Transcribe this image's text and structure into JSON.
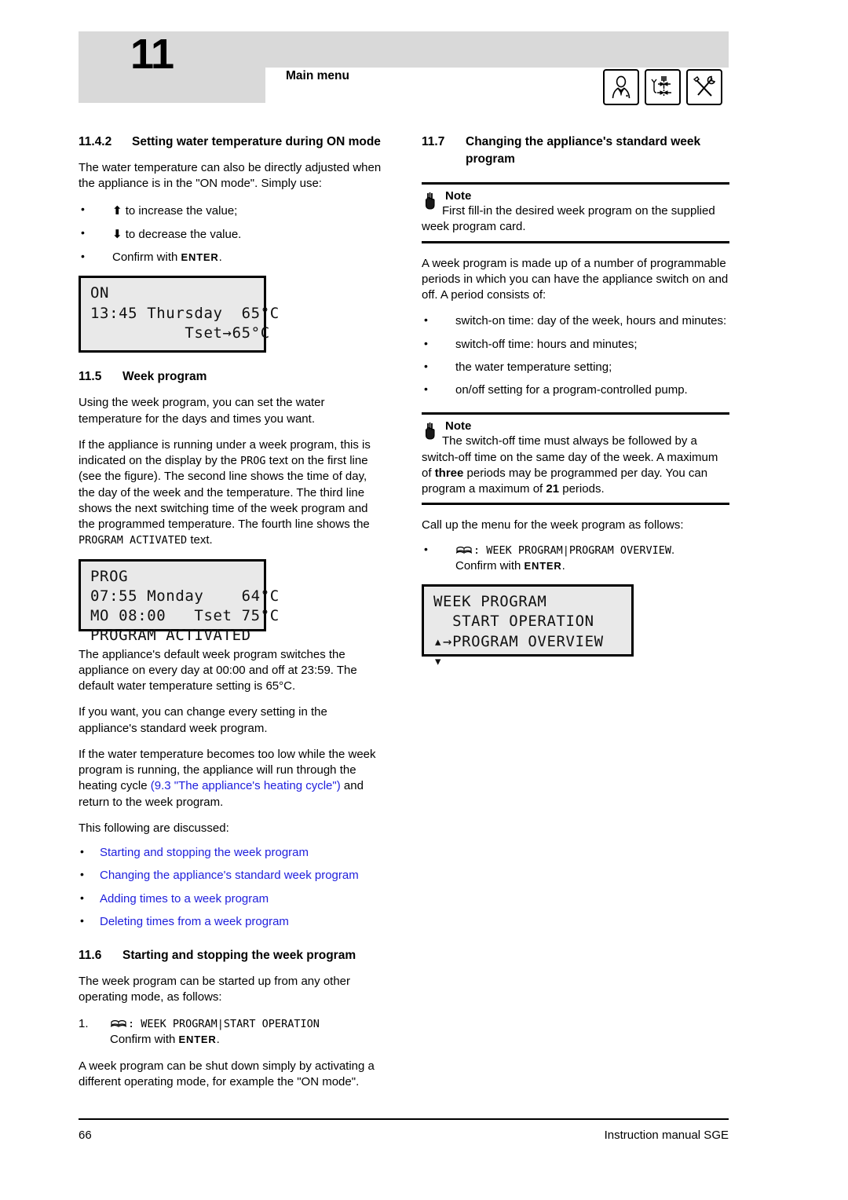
{
  "header": {
    "chapter_number": "11",
    "title": "Main menu",
    "icons": [
      "user-person-icon",
      "valve-piping-icon",
      "tools-crossed-icon"
    ]
  },
  "left_column": {
    "section_1142": {
      "number": "11.4.2",
      "title": "Setting water temperature during ON mode",
      "intro": "The water temperature can also be directly adjusted when the appliance is in the \"ON mode\". Simply use:",
      "bullets": [
        {
          "arrow": "⬆",
          "text": "to increase the value;"
        },
        {
          "arrow": "⬇",
          "text": "to decrease the value."
        },
        {
          "arrow": "",
          "text_before": "Confirm with ",
          "enter": "ENTER",
          "text_after": "."
        }
      ],
      "lcd": {
        "line1": "ON",
        "line2": "13:45 Thursday  65°C",
        "line3": "          Tset→65°C",
        "line4": ""
      }
    },
    "section_115": {
      "number": "11.5",
      "title": "Week program",
      "para1": "Using the week program, you can set the water temperature for the days and times you want.",
      "para2_a": "If the appliance is running under a week program, this is indicated on the display by the ",
      "para2_mono1": "PROG",
      "para2_b": " text on the first line (see the figure). The second line shows the time of day, the day of the week and the temperature. The third line shows the next switching time of the week program and the programmed temperature. The fourth line shows the ",
      "para2_mono2": "PROGRAM ACTIVATED",
      "para2_c": " text.",
      "lcd": {
        "line1": "PROG",
        "line2": "07:55 Monday    64°C",
        "line3": "MO 08:00   Tset 75°C",
        "line4": "PROGRAM ACTIVATED"
      },
      "para3": "The appliance's default week program switches the appliance on every day at 00:00 and off at 23:59. The default water temperature setting is 65°C.",
      "para4": "If you want, you can change every setting in the appliance's standard week program.",
      "para5_a": "If the water temperature becomes too low while the week program is running, the appliance will run through the heating cycle ",
      "para5_link": "(9.3 \"The appliance's heating cycle\")",
      "para5_b": " and return to the week program.",
      "para6": "This following are discussed:",
      "link_list": [
        "Starting and stopping the week program",
        "Changing the appliance's standard week program",
        "Adding times to a week program",
        "Deleting times from a week program"
      ]
    },
    "section_116": {
      "number": "11.6",
      "title": "Starting and stopping the week program",
      "para1": "The week program can be started up from any other operating mode, as follows:",
      "step_number": "1.",
      "step_icon": "book-menu-icon",
      "step_mono": ": WEEK PROGRAM|START OPERATION",
      "step_confirm_before": "Confirm with ",
      "step_confirm_enter": "ENTER",
      "step_confirm_after": ".",
      "para2": "A week program can be shut down simply by activating a different operating mode, for example the \"ON mode\"."
    }
  },
  "right_column": {
    "section_117": {
      "number": "11.7",
      "title": "Changing the appliance's standard week program",
      "note1": {
        "label": "Note",
        "icon": "pointing-hand-icon",
        "text": "First fill-in the desired week program on the supplied week program card."
      },
      "para1": "A week program is made up of a number of programmable periods in which you can have the appliance switch on and off. A period consists of:",
      "bullets": [
        "switch-on time: day of the week, hours and minutes:",
        "switch-off time: hours and minutes;",
        "the water temperature setting;",
        "on/off setting for a program-controlled pump."
      ],
      "note2": {
        "label": "Note",
        "icon": "pointing-hand-icon",
        "text_a": "The switch-off time must always be followed by a switch-off time on the same day of the week. A maximum of ",
        "bold1": "three",
        "text_b": " periods may be programmed per day. You can program a maximum of ",
        "bold2": "21",
        "text_c": " periods."
      },
      "para2": "Call up the menu for the week program as follows:",
      "bullet_step": {
        "icon": "book-menu-icon",
        "mono": ": WEEK PROGRAM|PROGRAM OVERVIEW",
        "period": ".",
        "confirm_before": "Confirm with ",
        "confirm_enter": "ENTER",
        "confirm_after": "."
      },
      "lcd": {
        "line1": "WEEK PROGRAM",
        "line2": "  START OPERATION",
        "line3": "▴→PROGRAM OVERVIEW",
        "line4": "▾"
      }
    }
  },
  "footer": {
    "page_number": "66",
    "manual_title": "Instruction manual SGE"
  },
  "colors": {
    "header_gray": "#d9d9d9",
    "link_blue": "#2020dd",
    "lcd_bg": "#e9e9e9",
    "text": "#000000"
  }
}
